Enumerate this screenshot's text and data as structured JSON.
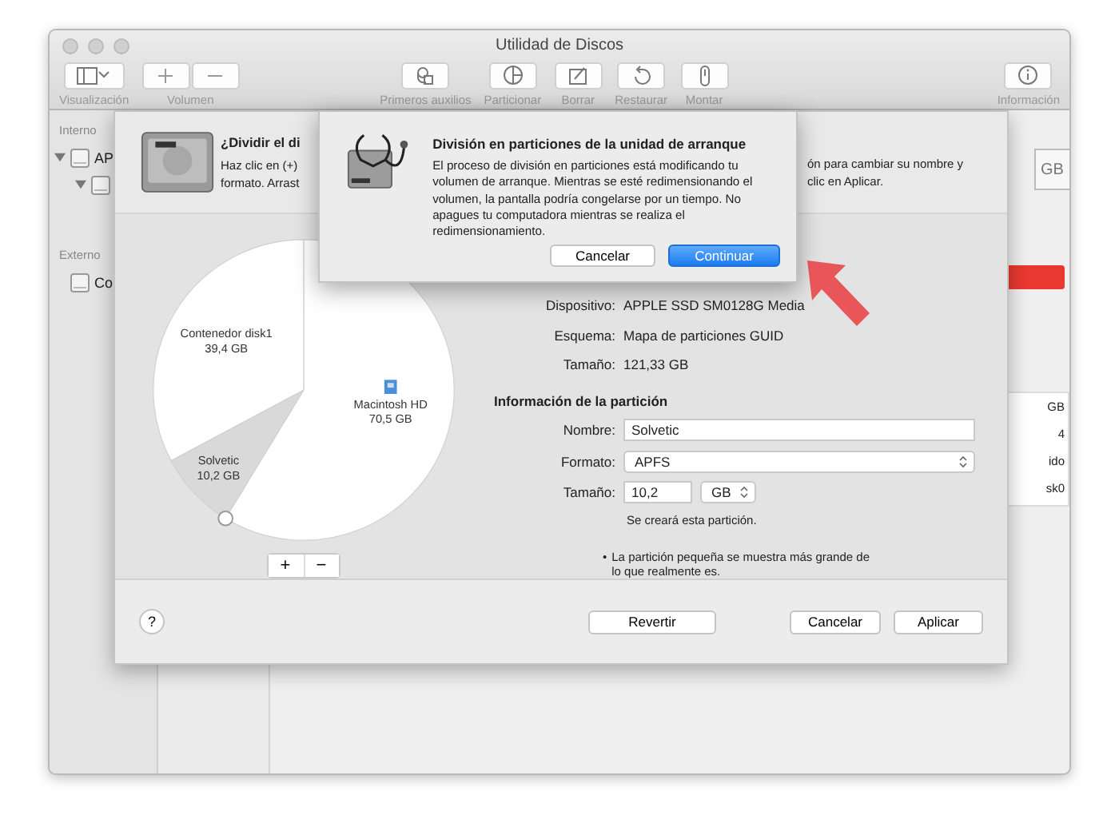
{
  "window": {
    "title": "Utilidad de Discos"
  },
  "toolbar": {
    "left": [
      {
        "label": "Visualización",
        "kind": "view"
      },
      {
        "label": "Volumen",
        "kind": "segmented"
      }
    ],
    "center": [
      {
        "label": "Primeros auxilios",
        "kind": "button"
      },
      {
        "label": "Particionar",
        "kind": "button"
      },
      {
        "label": "Borrar",
        "kind": "button"
      },
      {
        "label": "Restaurar",
        "kind": "button"
      },
      {
        "label": "Montar",
        "kind": "button"
      }
    ],
    "right": [
      {
        "label": "Información",
        "kind": "button"
      }
    ]
  },
  "sidebar": {
    "sections": [
      {
        "header": "Interno",
        "items": [
          {
            "label": "AP",
            "expanded": true,
            "children": [
              {
                "expanded": true
              }
            ]
          }
        ]
      },
      {
        "header": "Externo",
        "items": [
          {
            "label": "Co"
          }
        ]
      }
    ]
  },
  "background_panel": {
    "size_fragment": "GB",
    "details": [
      "GB",
      "4",
      "ido",
      "sk0"
    ]
  },
  "sheet": {
    "title": "¿Dividir el di",
    "description_left": [
      "Haz clic en (+)",
      "formato. Arrast"
    ],
    "description_right": [
      "ón para cambiar su nombre y",
      "clic en Aplicar."
    ],
    "partition_map": {
      "chart_data": {
        "type": "pie",
        "categories": [
          "Macintosh HD",
          "Solvetic",
          "Contenedor disk1"
        ],
        "values": [
          70.5,
          10.2,
          39.4
        ],
        "value_labels": [
          "70,5 GB",
          "10,2 GB",
          "39,4 GB"
        ]
      },
      "slice_selected": [
        false,
        true,
        false
      ]
    },
    "map_buttons": [
      "+",
      "−"
    ],
    "device_info": [
      {
        "label": "Dispositivo:",
        "value": "APPLE SSD SM0128G Media"
      },
      {
        "label": "Esquema:",
        "value": "Mapa de particiones GUID"
      },
      {
        "label": "Tamaño:",
        "value": "121,33 GB"
      }
    ],
    "partition_heading": "Información de la partición",
    "fields": [
      {
        "label": "Nombre:",
        "kind": "text",
        "value": "Solvetic"
      },
      {
        "label": "Formato:",
        "kind": "select",
        "value": "APFS"
      },
      {
        "label": "Tamaño:",
        "kind": "size",
        "value": "10,2",
        "unit": "GB"
      }
    ],
    "size_note": "Se creará esta partición.",
    "footnote_bullet": "•",
    "footnote": "La partición pequeña se muestra más grande de lo que realmente es.",
    "help": "?",
    "buttons": [
      "Revertir",
      "Cancelar",
      "Aplicar"
    ]
  },
  "dialog": {
    "title": "División en particiones de la unidad de arranque",
    "message": "El proceso de división en particiones está modificando tu volumen de arranque. Mientras se esté redimensionando el volumen, la pantalla podría congelarse por un tiempo. No apagues tu computadora mientras se realiza el redimensionamiento.",
    "buttons": [
      {
        "label": "Cancelar",
        "default": false
      },
      {
        "label": "Continuar",
        "default": true
      }
    ]
  }
}
